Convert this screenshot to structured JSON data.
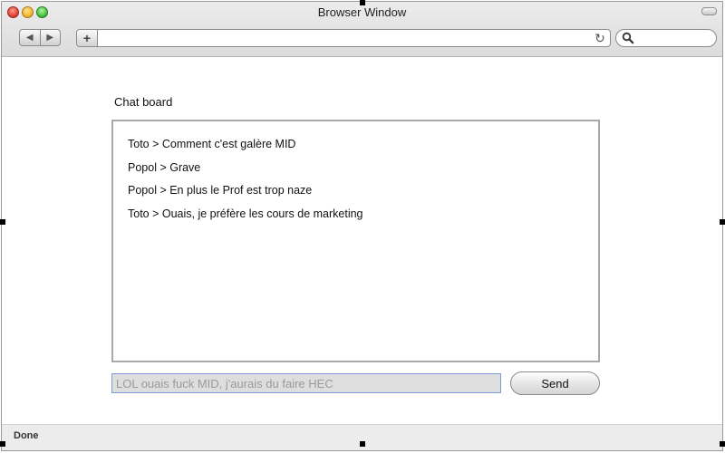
{
  "window": {
    "title": "Browser Window",
    "address": {
      "value": "",
      "placeholder": ""
    },
    "search": {
      "value": "",
      "placeholder": ""
    },
    "add_label": "+",
    "back_label": "◀",
    "forward_label": "▶",
    "reload_label": "↻"
  },
  "chat": {
    "title": "Chat board",
    "messages": [
      "Toto > Comment c'est galère MID",
      "Popol > Grave",
      "Popol > En plus le Prof est trop naze",
      "Toto > Ouais, je préfère les cours de marketing"
    ],
    "input_placeholder": "LOL ouais fuck MID, j'aurais du faire HEC",
    "send_label": "Send"
  },
  "status": {
    "text": "Done"
  },
  "colors": {
    "close": "#e0443a",
    "minimize": "#f2b632",
    "maximize": "#48c23c",
    "input_border": "#7f9bd9"
  }
}
